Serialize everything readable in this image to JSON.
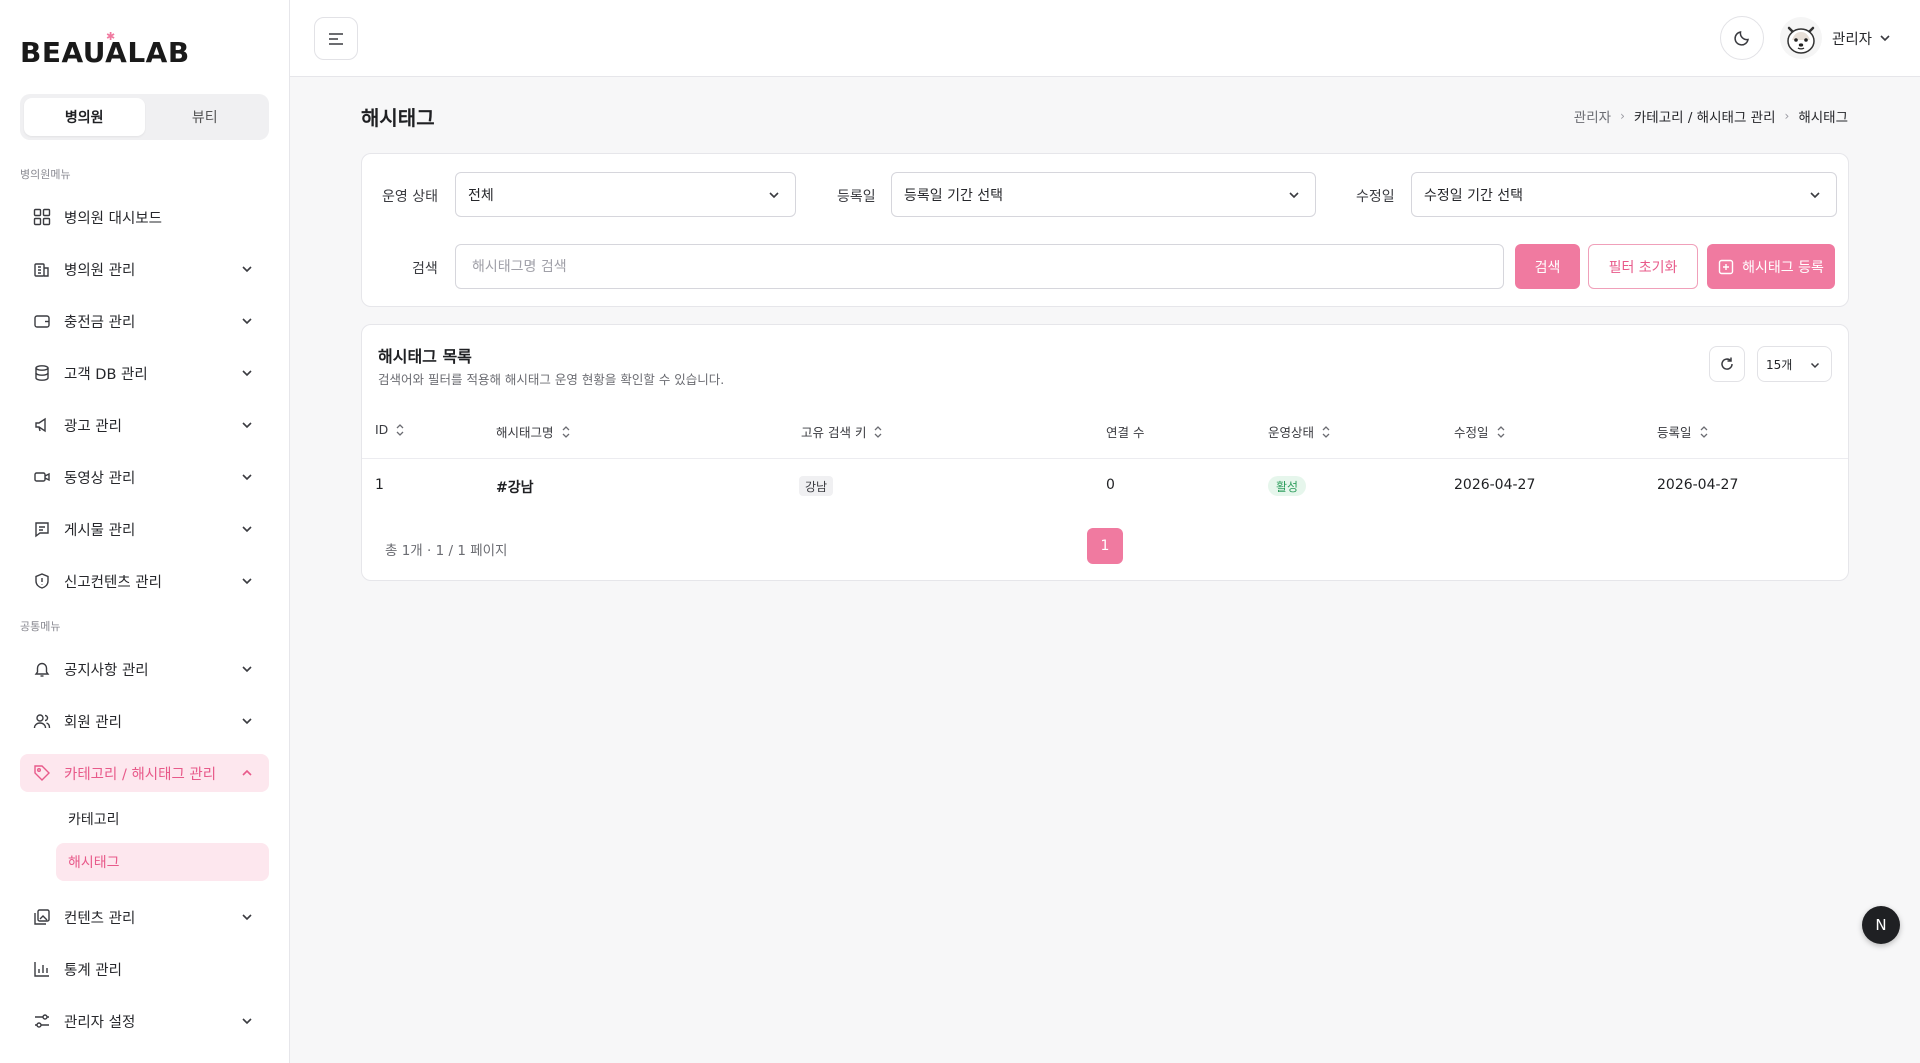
{
  "brand": {
    "logo": "BEAUALAB"
  },
  "sidebar": {
    "segment": [
      "병의원",
      "뷰티"
    ],
    "section_clinic": "병의원메뉴",
    "section_common": "공통메뉴",
    "items": [
      {
        "label": "병의원 대시보드",
        "icon": "grid-icon"
      },
      {
        "label": "병의원 관리",
        "icon": "building-icon"
      },
      {
        "label": "충전금 관리",
        "icon": "wallet-icon"
      },
      {
        "label": "고객 DB 관리",
        "icon": "database-icon"
      },
      {
        "label": "광고 관리",
        "icon": "megaphone-icon"
      },
      {
        "label": "동영상 관리",
        "icon": "video-icon"
      },
      {
        "label": "게시물 관리",
        "icon": "message-icon"
      },
      {
        "label": "신고컨텐츠 관리",
        "icon": "shield-icon"
      },
      {
        "label": "공지사항 관리",
        "icon": "bell-icon"
      },
      {
        "label": "회원 관리",
        "icon": "users-icon"
      },
      {
        "label": "카테고리 / 해시태그 관리",
        "icon": "tag-icon"
      },
      {
        "label": "컨텐츠 관리",
        "icon": "images-icon"
      },
      {
        "label": "통계 관리",
        "icon": "bar-chart-icon"
      },
      {
        "label": "관리자 설정",
        "icon": "settings-icon"
      }
    ],
    "sub_items": [
      "카테고리",
      "해시태그"
    ]
  },
  "header": {
    "user_name": "관리자"
  },
  "page": {
    "title": "해시태그",
    "breadcrumb": [
      "관리자",
      "카테고리 / 해시태그 관리",
      "해시태그"
    ]
  },
  "filters": {
    "status_label": "운영 상태",
    "status_value": "전체",
    "created_label": "등록일",
    "created_value": "등록일 기간 선택",
    "updated_label": "수정일",
    "updated_value": "수정일 기간 선택",
    "search_label": "검색",
    "search_placeholder": "해시태그명 검색",
    "search_btn": "검색",
    "reset_btn": "필터 초기화",
    "create_btn": "해시태그 등록"
  },
  "list": {
    "title": "해시태그 목록",
    "subtitle": "검색어와 필터를 적용해 해시태그 운영 현황을 확인할 수 있습니다.",
    "per_page": "15개",
    "columns": [
      "ID",
      "해시태그명",
      "고유 검색 키",
      "연결 수",
      "운영상태",
      "수정일",
      "등록일"
    ],
    "rows": [
      {
        "id": "1",
        "name": "#강남",
        "key": "강남",
        "count": "0",
        "status": "활성",
        "updated": "2026-04-27",
        "created": "2026-04-27"
      }
    ],
    "pager_info": "총 1개 · 1 / 1 페이지",
    "current_page": "1"
  },
  "colors": {
    "accent": "#f07aa0",
    "accent_text": "#e85a8a",
    "active_bg": "#fde7ee",
    "success": "#2f9e5e"
  },
  "floating": {
    "label": "N"
  }
}
